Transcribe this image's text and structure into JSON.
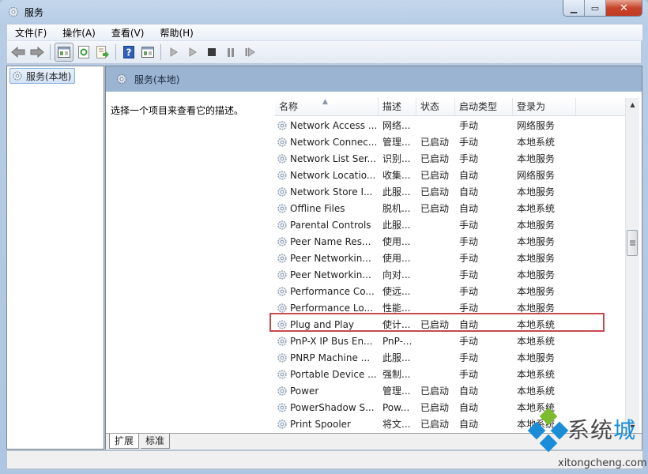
{
  "window": {
    "title": "服务",
    "caption_buttons": {
      "minimize": "▁",
      "maximize": "▭",
      "close": "✕"
    }
  },
  "menubar": {
    "items": [
      {
        "label": "文件(F)"
      },
      {
        "label": "操作(A)"
      },
      {
        "label": "查看(V)"
      },
      {
        "label": "帮助(H)"
      }
    ]
  },
  "toolbar": {
    "buttons": [
      {
        "icon": "back-arrow-icon"
      },
      {
        "icon": "forward-arrow-icon"
      },
      {
        "icon": "show-hide-console-tree-icon"
      },
      {
        "icon": "refresh-icon"
      },
      {
        "icon": "export-list-icon"
      },
      {
        "icon": "help-icon"
      },
      {
        "icon": "show-action-pane-icon"
      },
      {
        "icon": "start-service-icon"
      },
      {
        "icon": "start-service-alt-icon"
      },
      {
        "icon": "stop-service-icon"
      },
      {
        "icon": "pause-service-icon"
      },
      {
        "icon": "restart-service-icon"
      }
    ]
  },
  "tree": {
    "items": [
      {
        "label": "服务(本地)",
        "icon": "gear-icon",
        "selected": true
      }
    ]
  },
  "main": {
    "header_title": "服务(本地)",
    "description_prompt": "选择一个项目来查看它的描述。",
    "columns": [
      {
        "label": "名称",
        "sorted": "ascending"
      },
      {
        "label": "描述"
      },
      {
        "label": "状态"
      },
      {
        "label": "启动类型"
      },
      {
        "label": "登录为"
      }
    ],
    "rows": [
      {
        "name": "Network Access ...",
        "desc": "网络...",
        "state": "",
        "startup": "手动",
        "logon": "网络服务"
      },
      {
        "name": "Network Connec...",
        "desc": "管理...",
        "state": "已启动",
        "startup": "手动",
        "logon": "本地系统"
      },
      {
        "name": "Network List Ser...",
        "desc": "识别...",
        "state": "已启动",
        "startup": "手动",
        "logon": "本地服务"
      },
      {
        "name": "Network Locatio...",
        "desc": "收集...",
        "state": "已启动",
        "startup": "自动",
        "logon": "网络服务"
      },
      {
        "name": "Network Store I...",
        "desc": "此服...",
        "state": "已启动",
        "startup": "自动",
        "logon": "本地服务"
      },
      {
        "name": "Offline Files",
        "desc": "脱机...",
        "state": "已启动",
        "startup": "自动",
        "logon": "本地系统"
      },
      {
        "name": "Parental Controls",
        "desc": "此服...",
        "state": "",
        "startup": "手动",
        "logon": "本地服务"
      },
      {
        "name": "Peer Name Res...",
        "desc": "使用...",
        "state": "",
        "startup": "手动",
        "logon": "本地服务"
      },
      {
        "name": "Peer Networkin...",
        "desc": "使用...",
        "state": "",
        "startup": "手动",
        "logon": "本地服务"
      },
      {
        "name": "Peer Networkin...",
        "desc": "向对...",
        "state": "",
        "startup": "手动",
        "logon": "本地服务"
      },
      {
        "name": "Performance Co...",
        "desc": "使远...",
        "state": "",
        "startup": "手动",
        "logon": "本地服务"
      },
      {
        "name": "Performance Lo...",
        "desc": "性能...",
        "state": "",
        "startup": "手动",
        "logon": "本地服务"
      },
      {
        "name": "Plug and Play",
        "desc": "使计...",
        "state": "已启动",
        "startup": "自动",
        "logon": "本地系统",
        "highlighted": true
      },
      {
        "name": "PnP-X IP Bus En...",
        "desc": "PnP-...",
        "state": "",
        "startup": "手动",
        "logon": "本地系统"
      },
      {
        "name": "PNRP Machine ...",
        "desc": "此服...",
        "state": "",
        "startup": "手动",
        "logon": "本地服务"
      },
      {
        "name": "Portable Device ...",
        "desc": "强制...",
        "state": "",
        "startup": "手动",
        "logon": "本地系统"
      },
      {
        "name": "Power",
        "desc": "管理...",
        "state": "已启动",
        "startup": "自动",
        "logon": "本地系统"
      },
      {
        "name": "PowerShadow S...",
        "desc": "Pow...",
        "state": "已启动",
        "startup": "自动",
        "logon": "本地系统"
      },
      {
        "name": "Print Spooler",
        "desc": "将文...",
        "state": "已启动",
        "startup": "自动",
        "logon": "本地系统"
      }
    ],
    "scrollbar": {
      "position_fraction": 0.42
    },
    "tabs": [
      {
        "label": "扩展",
        "active": true
      },
      {
        "label": "标准",
        "active": false
      }
    ]
  },
  "watermark": {
    "text_main": "系统",
    "text_accent": "城",
    "url": "xitongcheng.com",
    "colors": {
      "blue": "#1a8dd8",
      "green": "#7dbb2f"
    }
  },
  "colors": {
    "highlight_border": "#c74a4f",
    "header_band": "#9bb4d1"
  }
}
